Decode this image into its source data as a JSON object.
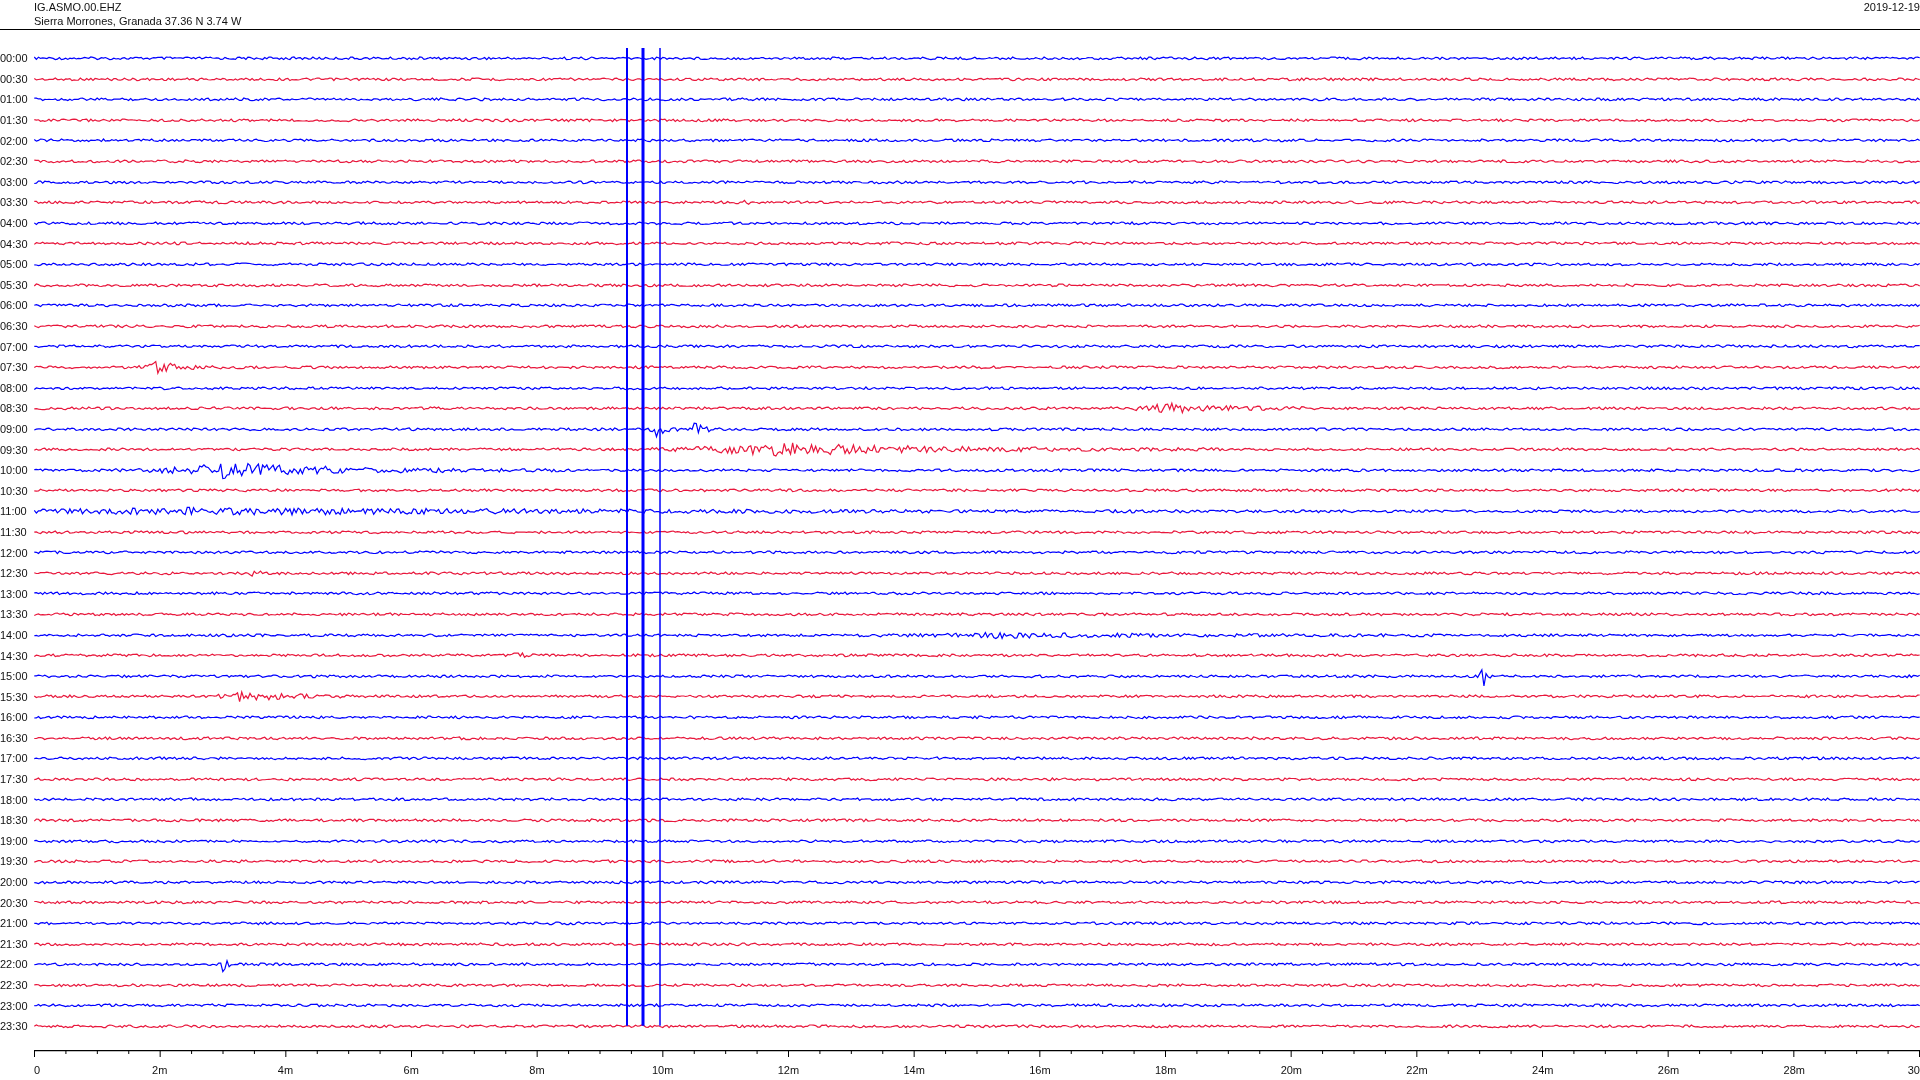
{
  "header": {
    "channel": "IG.ASMO.00.EHZ",
    "location": "Sierra Morrones, Granada  37.36 N 3.74 W",
    "date": "2019-12-19"
  },
  "rows": [
    {
      "time": "00:00",
      "color": "#0000ff"
    },
    {
      "time": "00:30",
      "color": "#e8173c"
    },
    {
      "time": "01:00",
      "color": "#0000ff"
    },
    {
      "time": "01:30",
      "color": "#e8173c"
    },
    {
      "time": "02:00",
      "color": "#0000ff"
    },
    {
      "time": "02:30",
      "color": "#e8173c"
    },
    {
      "time": "03:00",
      "color": "#0000ff"
    },
    {
      "time": "03:30",
      "color": "#e8173c"
    },
    {
      "time": "04:00",
      "color": "#0000ff"
    },
    {
      "time": "04:30",
      "color": "#e8173c"
    },
    {
      "time": "05:00",
      "color": "#0000ff"
    },
    {
      "time": "05:30",
      "color": "#e8173c"
    },
    {
      "time": "06:00",
      "color": "#0000ff"
    },
    {
      "time": "06:30",
      "color": "#e8173c"
    },
    {
      "time": "07:00",
      "color": "#0000ff"
    },
    {
      "time": "07:30",
      "color": "#e8173c"
    },
    {
      "time": "08:00",
      "color": "#0000ff"
    },
    {
      "time": "08:30",
      "color": "#e8173c"
    },
    {
      "time": "09:00",
      "color": "#0000ff"
    },
    {
      "time": "09:30",
      "color": "#e8173c"
    },
    {
      "time": "10:00",
      "color": "#0000ff"
    },
    {
      "time": "10:30",
      "color": "#e8173c"
    },
    {
      "time": "11:00",
      "color": "#0000ff"
    },
    {
      "time": "11:30",
      "color": "#e8173c"
    },
    {
      "time": "12:00",
      "color": "#0000ff"
    },
    {
      "time": "12:30",
      "color": "#e8173c"
    },
    {
      "time": "13:00",
      "color": "#0000ff"
    },
    {
      "time": "13:30",
      "color": "#e8173c"
    },
    {
      "time": "14:00",
      "color": "#0000ff"
    },
    {
      "time": "14:30",
      "color": "#e8173c"
    },
    {
      "time": "15:00",
      "color": "#0000ff"
    },
    {
      "time": "15:30",
      "color": "#e8173c"
    },
    {
      "time": "16:00",
      "color": "#0000ff"
    },
    {
      "time": "16:30",
      "color": "#e8173c"
    },
    {
      "time": "17:00",
      "color": "#0000ff"
    },
    {
      "time": "17:30",
      "color": "#e8173c"
    },
    {
      "time": "18:00",
      "color": "#0000ff"
    },
    {
      "time": "18:30",
      "color": "#e8173c"
    },
    {
      "time": "19:00",
      "color": "#0000ff"
    },
    {
      "time": "19:30",
      "color": "#e8173c"
    },
    {
      "time": "20:00",
      "color": "#0000ff"
    },
    {
      "time": "20:30",
      "color": "#e8173c"
    },
    {
      "time": "21:00",
      "color": "#0000ff"
    },
    {
      "time": "21:30",
      "color": "#e8173c"
    },
    {
      "time": "22:00",
      "color": "#0000ff"
    },
    {
      "time": "22:30",
      "color": "#e8173c"
    },
    {
      "time": "23:00",
      "color": "#0000ff"
    },
    {
      "time": "23:30",
      "color": "#e8173c"
    }
  ],
  "axis": {
    "labels": [
      "0",
      "2m",
      "4m",
      "6m",
      "8m",
      "10m",
      "12m",
      "14m",
      "16m",
      "18m",
      "20m",
      "22m",
      "24m",
      "26m",
      "28m",
      "30"
    ]
  }
}
